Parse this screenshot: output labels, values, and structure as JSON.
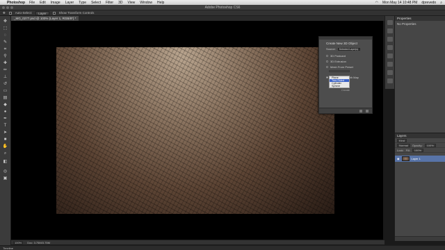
{
  "menubar": {
    "app_name": "Photoshop",
    "items": [
      "File",
      "Edit",
      "Image",
      "Layer",
      "Type",
      "Select",
      "Filter",
      "3D",
      "View",
      "Window",
      "Help"
    ],
    "clock": "Mon May 14  10:48 PM",
    "user": "dprevedo"
  },
  "window": {
    "title": "Adobe Photoshop CS6"
  },
  "options_bar": {
    "auto_select_label": "Auto-Select:",
    "auto_select_value": "Layer",
    "transform_label": "Show Transform Controls"
  },
  "document": {
    "tab_title": "_MG_0277.psd @ 100% (Layer 1, RGB/8*) *"
  },
  "dialog_3d": {
    "title": "Create New 3D Object",
    "source_label": "Source:",
    "source_value": "Selected Layer(s)",
    "options": [
      "3D Postcard",
      "3D Extrusion",
      "Mesh From Preset",
      "Mesh From Depth Map"
    ],
    "depth_map_menu": [
      "Plane",
      "Two-Sided Plane",
      "Cylinder",
      "Sphere"
    ],
    "selected_menu_item": "Two-Sided Plane",
    "create_label": "Create"
  },
  "properties": {
    "title": "Properties",
    "empty_text": "No Properties"
  },
  "layers": {
    "title": "Layers",
    "kind_label": "Kind",
    "blend_mode": "Normal",
    "opacity_label": "Opacity:",
    "opacity_value": "100%",
    "lock_label": "Lock:",
    "fill_label": "Fill:",
    "fill_value": "100%",
    "layer_name": "Layer 1"
  },
  "status_bar": {
    "zoom": "100%",
    "doc_size": "Doc: 3.75M/3.75M"
  },
  "timeline": {
    "label": "Timeline"
  }
}
